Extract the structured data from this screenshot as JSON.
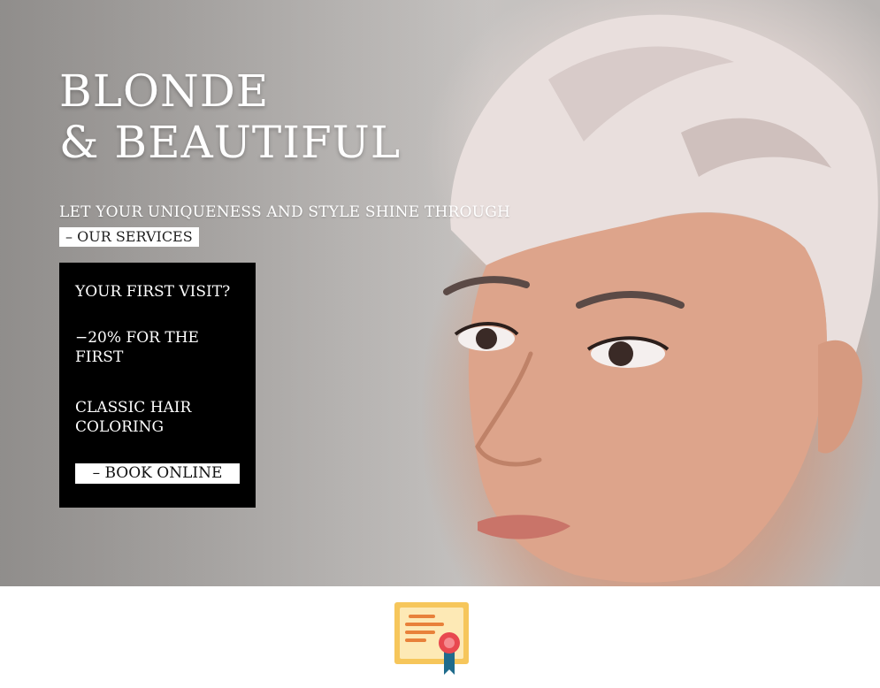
{
  "hero": {
    "title_line1": "BLONDE",
    "title_line2": "& BEAUTIFUL",
    "subtitle": "LET YOUR UNIQUENESS AND STYLE SHINE THROUGH",
    "services_link": "– OUR SERVICES"
  },
  "promo": {
    "question": "YOUR FIRST VISIT?",
    "discount": "−20% FOR THE FIRST",
    "service": "CLASSIC HAIR COLORING",
    "book_button": "– BOOK ONLINE"
  },
  "icons": {
    "certificate": "certificate-icon"
  },
  "colors": {
    "promo_bg": "#000000",
    "certificate_paper": "#fde9b5",
    "certificate_border": "#f6c65b",
    "certificate_lines": "#e8813a",
    "ribbon_seal": "#e8484f",
    "ribbon_tail": "#1f6b8c"
  }
}
